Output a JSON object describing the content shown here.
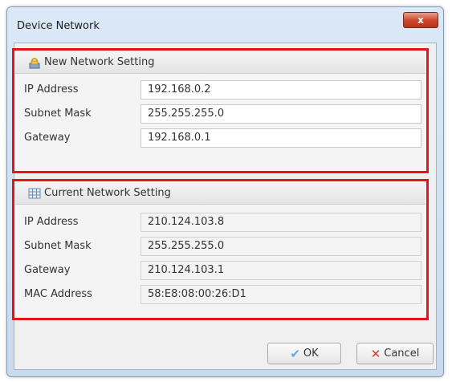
{
  "window": {
    "title": "Device Network",
    "close_label": "x"
  },
  "new_network": {
    "header": "New Network Setting",
    "header_icon": "network-lock-icon",
    "fields": [
      {
        "label": "IP Address",
        "value": "192.168.0.2"
      },
      {
        "label": "Subnet Mask",
        "value": "255.255.255.0"
      },
      {
        "label": "Gateway",
        "value": "192.168.0.1"
      }
    ]
  },
  "current_network": {
    "header": "Current Network Setting",
    "header_icon": "grid-table-icon",
    "fields": [
      {
        "label": "IP Address",
        "value": "210.124.103.8"
      },
      {
        "label": "Subnet Mask",
        "value": "255.255.255.0"
      },
      {
        "label": "Gateway",
        "value": "210.124.103.1"
      },
      {
        "label": "MAC Address",
        "value": "58:E8:08:00:26:D1"
      }
    ]
  },
  "buttons": {
    "ok_label": "OK",
    "cancel_label": "Cancel"
  },
  "colors": {
    "highlight_border": "#e3141b",
    "title_close": "#cf4a2d"
  }
}
